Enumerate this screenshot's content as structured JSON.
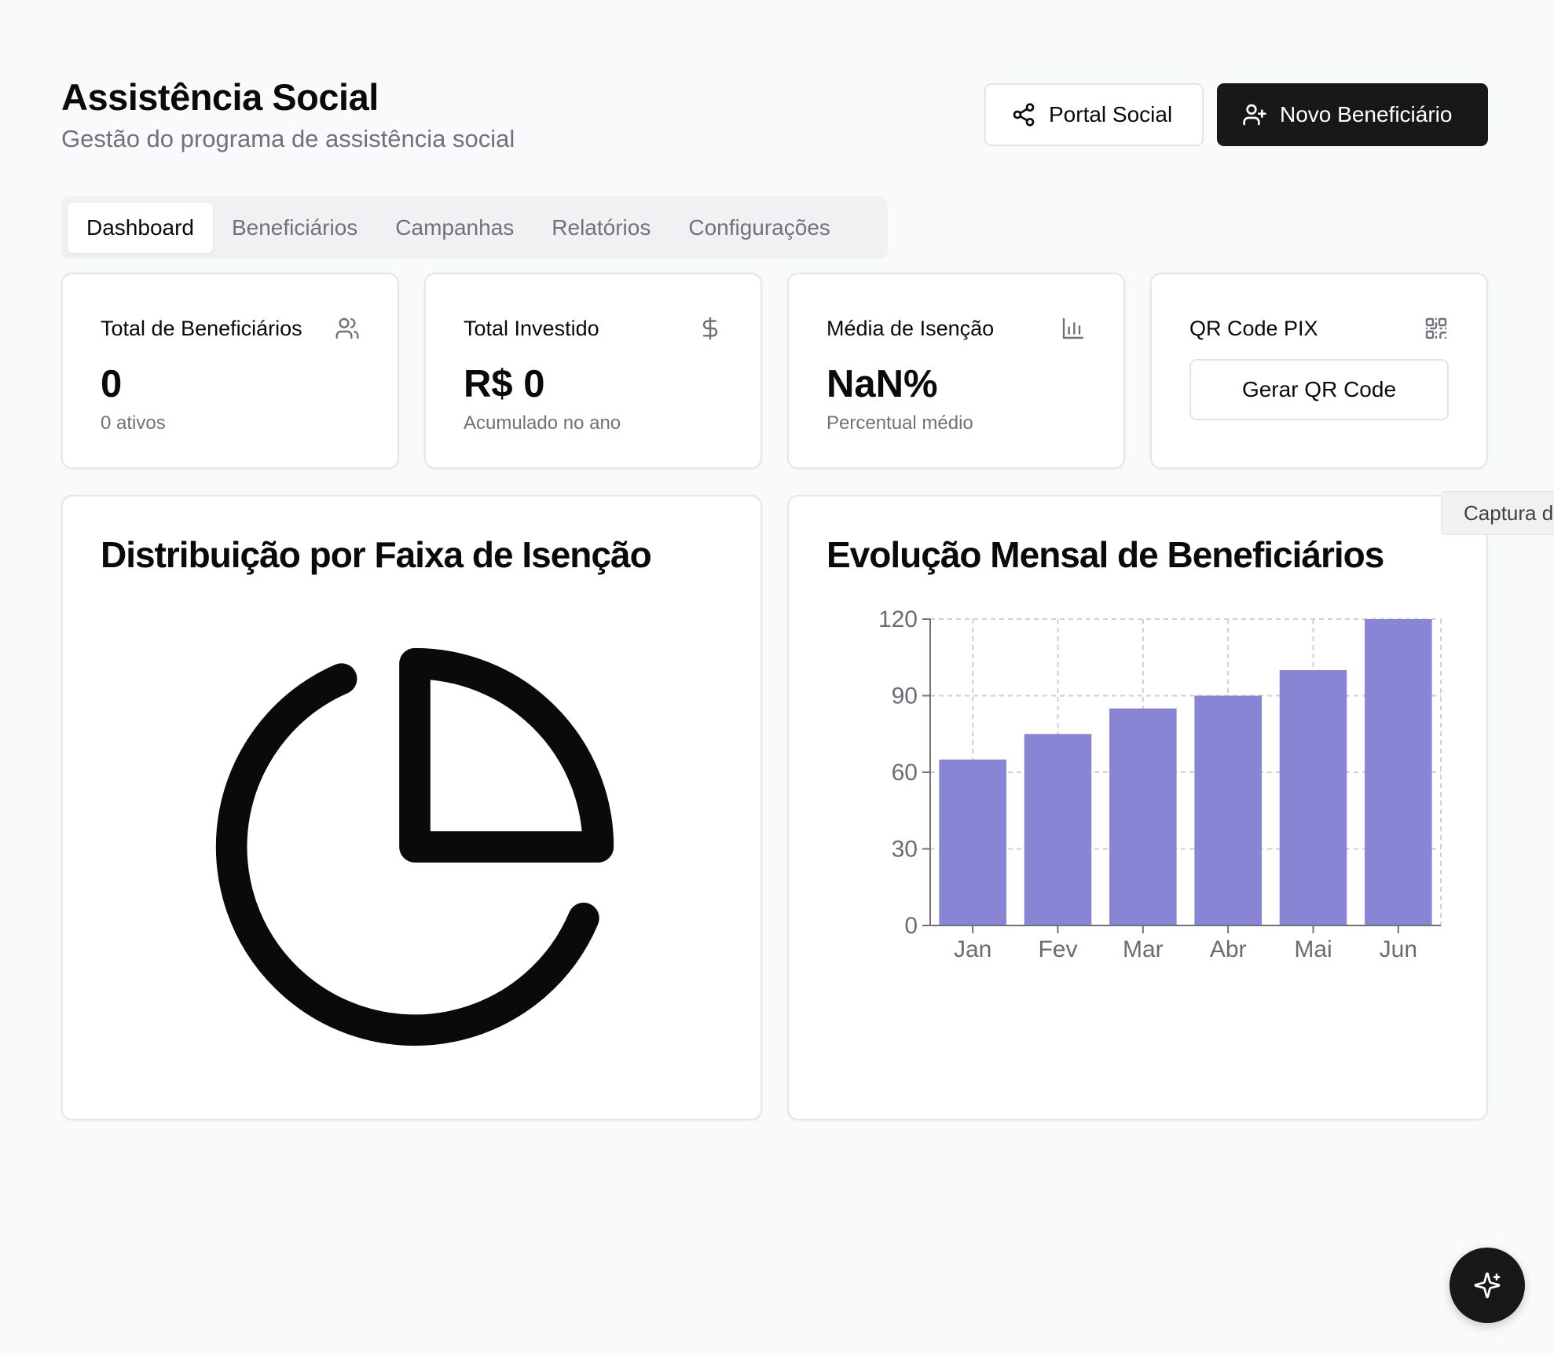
{
  "header": {
    "title": "Assistência Social",
    "subtitle": "Gestão do programa de assistência social",
    "portal_button": "Portal Social",
    "new_button": "Novo Beneficiário"
  },
  "tabs": [
    {
      "label": "Dashboard",
      "active": true
    },
    {
      "label": "Beneficiários",
      "active": false
    },
    {
      "label": "Campanhas",
      "active": false
    },
    {
      "label": "Relatórios",
      "active": false
    },
    {
      "label": "Configurações",
      "active": false
    }
  ],
  "stats": {
    "beneficiaries": {
      "label": "Total de Beneficiários",
      "value": "0",
      "sub": "0 ativos",
      "icon": "users-icon"
    },
    "invested": {
      "label": "Total Investido",
      "value": "R$ 0",
      "sub": "Acumulado no ano",
      "icon": "dollar-icon"
    },
    "exemption": {
      "label": "Média de Isenção",
      "value": "NaN%",
      "sub": "Percentual médio",
      "icon": "bar-chart-icon"
    },
    "pix": {
      "label": "QR Code PIX",
      "button": "Gerar QR Code",
      "icon": "qr-code-icon"
    }
  },
  "panels": {
    "distribution_title": "Distribuição por Faixa de Isenção",
    "evolution_title": "Evolução Mensal de Beneficiários"
  },
  "tooltip": "Captura d",
  "colors": {
    "bar": "#8886d4",
    "primary": "#18181b"
  },
  "chart_data": {
    "type": "bar",
    "categories": [
      "Jan",
      "Fev",
      "Mar",
      "Abr",
      "Mai",
      "Jun"
    ],
    "values": [
      65,
      75,
      85,
      90,
      100,
      120
    ],
    "yticks": [
      0,
      30,
      60,
      90,
      120
    ],
    "ylim": [
      0,
      120
    ],
    "grid": true
  }
}
